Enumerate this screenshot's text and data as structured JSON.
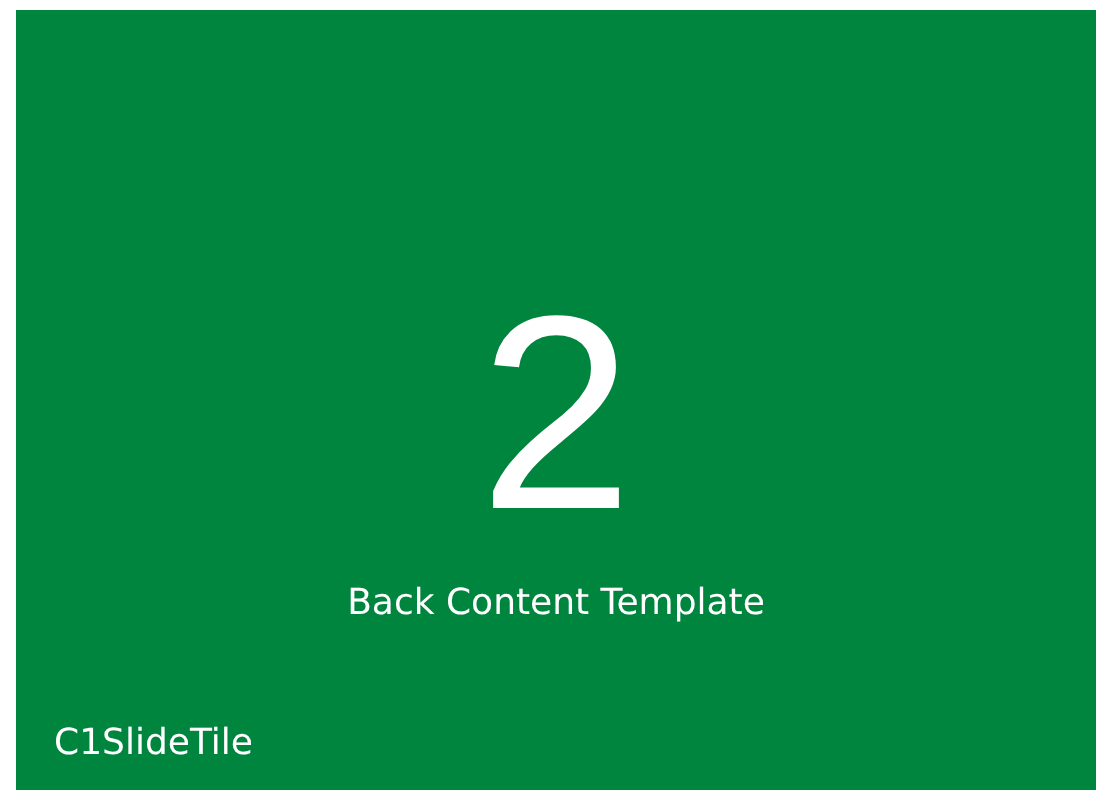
{
  "tile": {
    "number": "2",
    "content": "Back Content Template",
    "header": "C1SlideTile"
  }
}
